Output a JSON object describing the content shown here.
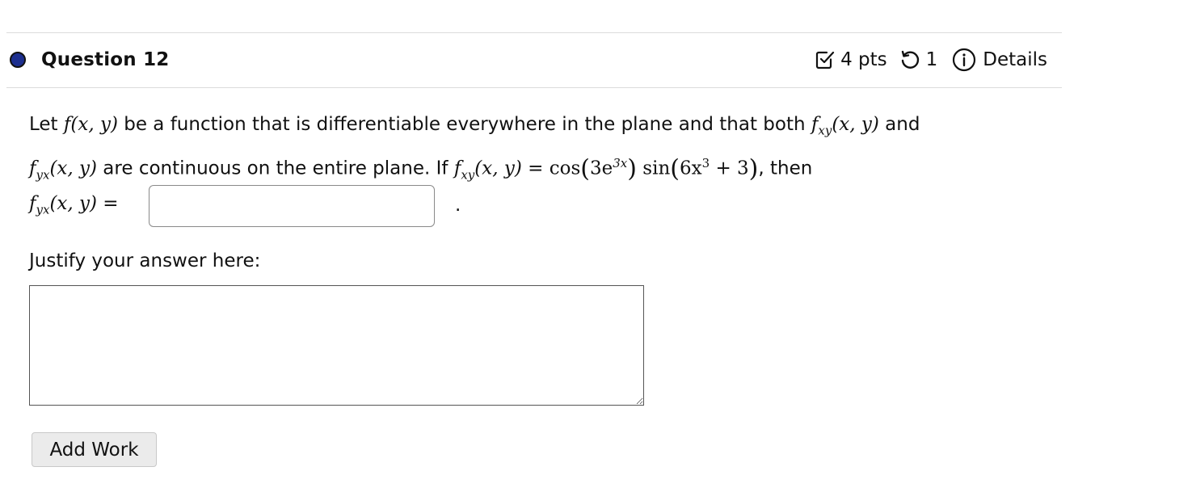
{
  "question": {
    "title": "Question 12",
    "points": "4 pts",
    "attempts": "1",
    "details_label": "Details"
  },
  "body": {
    "line1": {
      "t1": "Let ",
      "fxy_math": "f(x, y)",
      "t2": " be a function that is differentiable everywhere in the plane and that both ",
      "f_letter": "f",
      "sub_xy": "xy",
      "args": "(x, y)",
      "t3": " and"
    },
    "line2": {
      "f_letter": "f",
      "sub_yx": "yx",
      "args": "(x, y)",
      "t1": " are continuous on the entire plane. If ",
      "f2_letter": "f",
      "sub_xy": "xy",
      "args2": "(x, y)",
      "eq": " = ",
      "cos": "cos",
      "lparen": "(",
      "three_e": "3e",
      "exp1": "3x",
      "rparen": ")",
      "sin": " sin",
      "lparen2": "(",
      "six_x": "6x",
      "exp2": "3",
      "plus3": " + 3",
      "rparen2": ")",
      "t2": ", then"
    }
  },
  "answer": {
    "f_letter": "f",
    "sub_yx": "yx",
    "args": "(x, y)",
    "eq": " =",
    "value": "",
    "period": "."
  },
  "justify": {
    "label": "Justify your answer here:",
    "value": ""
  },
  "add_work_label": "Add Work",
  "colors": {
    "status_dot": "#1d2f8f",
    "rule": "#dcdcdc",
    "button_bg": "#ebebeb"
  },
  "icons": {
    "points": "checkbox-check-icon",
    "attempts": "retry-icon",
    "details": "info-circle-icon"
  }
}
